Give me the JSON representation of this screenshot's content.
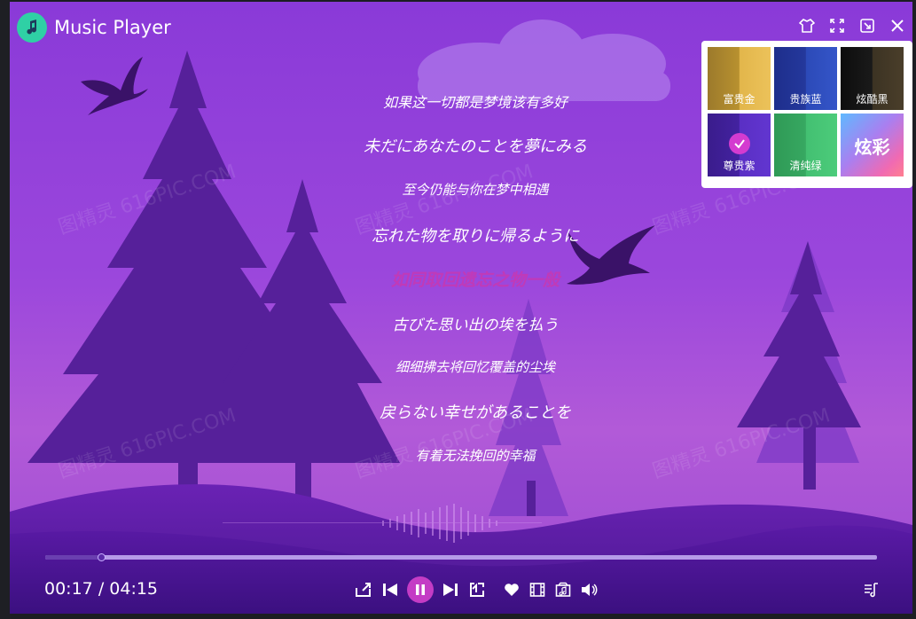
{
  "app": {
    "title": "Music Player",
    "logo_icon": "music-note-icon",
    "accent_color": "#c43cc5",
    "logo_color": "#2fd0a5"
  },
  "window_controls": [
    {
      "name": "skin-button",
      "icon": "tshirt-icon"
    },
    {
      "name": "fullscreen-button",
      "icon": "expand-icon"
    },
    {
      "name": "minimize-button",
      "icon": "mini-window-icon"
    },
    {
      "name": "close-button",
      "icon": "close-icon"
    }
  ],
  "skins": [
    {
      "label": "富贵金",
      "key": "gold",
      "selected": false
    },
    {
      "label": "贵族蓝",
      "key": "blue",
      "selected": false
    },
    {
      "label": "炫酷黑",
      "key": "black",
      "selected": false
    },
    {
      "label": "尊贵紫",
      "key": "purple",
      "selected": true
    },
    {
      "label": "清纯绿",
      "key": "green",
      "selected": false
    },
    {
      "label": "炫彩",
      "key": "color",
      "selected": false
    }
  ],
  "lyrics": {
    "current_index": 4,
    "lines": [
      "如果这一切都是梦境该有多好",
      "未だにあなたのことを夢にみる",
      "至今仍能与你在梦中相遇",
      "忘れた物を取りに帰るように",
      "如同取回遗忘之物一般",
      "古びた思い出の埃を払う",
      "细细拂去将回忆覆盖的尘埃",
      "戻らない幸せがあることを",
      "有着无法挽回的幸福"
    ]
  },
  "playback": {
    "current_time": "00:17",
    "separator": "/",
    "total_time": "04:15",
    "progress_fraction": 0.067,
    "is_playing": true
  },
  "controls": [
    {
      "name": "repeat-mode-button",
      "icon": "repeat-icon"
    },
    {
      "name": "previous-button",
      "icon": "skip-previous-icon"
    },
    {
      "name": "pause-button",
      "icon": "pause-icon"
    },
    {
      "name": "next-button",
      "icon": "skip-next-icon"
    },
    {
      "name": "loop-button",
      "icon": "loop-icon"
    }
  ],
  "extras": [
    {
      "name": "favorite-button",
      "icon": "heart-icon"
    },
    {
      "name": "mv-button",
      "icon": "film-icon"
    },
    {
      "name": "lyrics-display-button",
      "icon": "music-box-icon"
    },
    {
      "name": "volume-button",
      "icon": "speaker-icon"
    }
  ],
  "playlist_icon": "playlist-icon",
  "watermark_text": "图精灵 616PIC.COM"
}
